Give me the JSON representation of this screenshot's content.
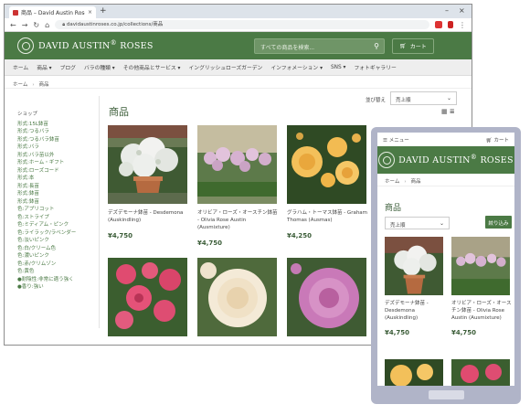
{
  "browser": {
    "tab_title": "商品 – David Austin Roses Japan",
    "tab_close": "×",
    "new_tab": "+",
    "url": "davidaustinroses.co.jp/collections/商品",
    "nav_back": "←",
    "nav_forward": "→",
    "nav_reload": "↻",
    "menu_dots": "⋮"
  },
  "header": {
    "logo_main": "DAVID AUSTIN",
    "logo_reg": "®",
    "logo_roses": "ROSES",
    "search_placeholder": "すべての商品を検索...",
    "cart_label": "カート"
  },
  "nav": [
    "ホーム",
    "商品 ▾",
    "ブログ",
    "バラの種類 ▾",
    "その他商品とサービス ▾",
    "イングリッシュローズガーデン",
    "インフォメーション ▾",
    "SNS ▾",
    "フォトギャラリー"
  ],
  "breadcrumb": {
    "home": "ホーム",
    "sep": "›",
    "current": "商品"
  },
  "page_title": "商品",
  "sort": {
    "label": "並び替え",
    "value": "売上順",
    "chevron": "⌄"
  },
  "grid_icons": "▦ ≣",
  "sidebar": {
    "heading": "ショップ",
    "items": [
      "形式:15L鉢苗",
      "形式:つるバラ",
      "形式:つるバラ鉢苗",
      "形式:バラ",
      "形式:バラ苗以外",
      "形式:ホーム・ギフト",
      "形式:ローズコード",
      "形式:本",
      "形式:長苗",
      "形式:鉢苗",
      "形式:鉢苗",
      "色:アプリコット",
      "色:ストライプ",
      "色:ミディアム・ピンク",
      "色:ライラック/ラベンダー",
      "色:淡いピンク",
      "色:白/クリーム色",
      "色:濃いピンク",
      "色:赤/クリムゾン",
      "色:黄色",
      "●耐陰性:非常に適う強く",
      "●香り:強い"
    ]
  },
  "products": [
    {
      "name": "デズデモーナ鉢苗 - Desdemona (Auskindling)",
      "price": "¥4,750"
    },
    {
      "name": "オリビア・ローズ・オースチン鉢苗 - Olivia Rose Austin (Ausmixture)",
      "price": "¥4,750"
    },
    {
      "name": "グラハム・トーマス鉢苗 - Graham Thomas (Ausmas)",
      "price": "¥4,250"
    }
  ],
  "mobile": {
    "menu_label": "メニュー",
    "cart_label": "カート",
    "title": "商品",
    "sort_value": "売上順",
    "filter_label": "絞り込み",
    "products": [
      {
        "name": "デズデモーナ鉢苗 - Desdemona (Auskindling)",
        "price": "¥4,750"
      },
      {
        "name": "オリビア・ローズ・オースチン鉢苗 - Olivia Rose Austin (Ausmixture)",
        "price": "¥4,750"
      }
    ]
  },
  "colors": {
    "brand_green": "#4b7a45",
    "price_green": "#3a5c37"
  }
}
